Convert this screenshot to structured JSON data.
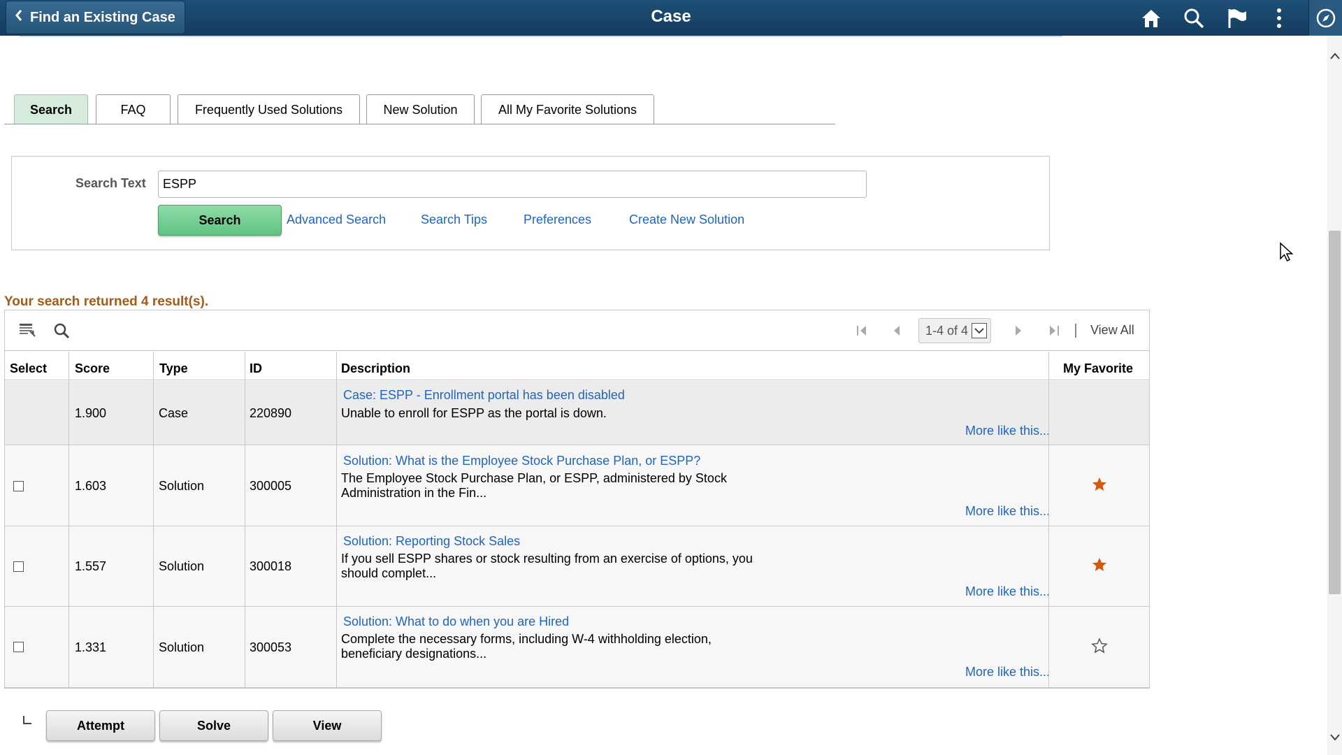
{
  "header": {
    "back_label": "Find an Existing Case",
    "title": "Case",
    "icons": [
      "home-icon",
      "search-icon",
      "flag-icon",
      "more-options-icon",
      "navigator-icon"
    ]
  },
  "tabs": [
    {
      "label": "Search",
      "active": true
    },
    {
      "label": "FAQ",
      "active": false
    },
    {
      "label": "Frequently Used Solutions",
      "active": false
    },
    {
      "label": "New Solution",
      "active": false
    },
    {
      "label": "All My Favorite Solutions",
      "active": false
    }
  ],
  "search": {
    "label": "Search Text",
    "value": "ESPP",
    "button_label": "Search",
    "links": [
      "Advanced Search",
      "Search Tips",
      "Preferences",
      "Create New Solution"
    ]
  },
  "results_message": "Your search returned 4 result(s).",
  "grid": {
    "pager": "1-4 of 4",
    "view_all": "View All",
    "columns": [
      "Select",
      "Score",
      "Type",
      "ID",
      "Description",
      "My Favorite"
    ],
    "rows": [
      {
        "selectable": false,
        "score": "1.900",
        "type": "Case",
        "id": "220890",
        "title": "Case: ESPP - Enrollment portal has been disabled",
        "text_line1": "Unable to enroll for ESPP as the portal is down.",
        "text_line2": "",
        "more": "More like this...",
        "favorite": "none"
      },
      {
        "selectable": true,
        "score": "1.603",
        "type": "Solution",
        "id": "300005",
        "title": "Solution: What is the Employee Stock Purchase Plan, or ESPP?",
        "text_line1": "The Employee Stock Purchase Plan, or ESPP, administered by Stock",
        "text_line2": "Administration in the Fin...",
        "more": "More like this...",
        "favorite": "filled"
      },
      {
        "selectable": true,
        "score": "1.557",
        "type": "Solution",
        "id": "300018",
        "title": "Solution: Reporting Stock Sales",
        "text_line1": "If you sell ESPP shares or stock resulting from an exercise of options, you",
        "text_line2": "should complet...",
        "more": "More like this...",
        "favorite": "filled"
      },
      {
        "selectable": true,
        "score": "1.331",
        "type": "Solution",
        "id": "300053",
        "title": "Solution: What to do when you are Hired",
        "text_line1": "Complete the necessary forms, including W-4 withholding election,",
        "text_line2": "beneficiary designations...",
        "more": "More like this...",
        "favorite": "empty"
      }
    ]
  },
  "actions": [
    "Attempt",
    "Solve",
    "View"
  ],
  "colors": {
    "header": "#1b4a70",
    "link": "#2065c0",
    "results": "#a55a16",
    "favorite": "#d25a0f",
    "search_button": "#6fcc90"
  }
}
